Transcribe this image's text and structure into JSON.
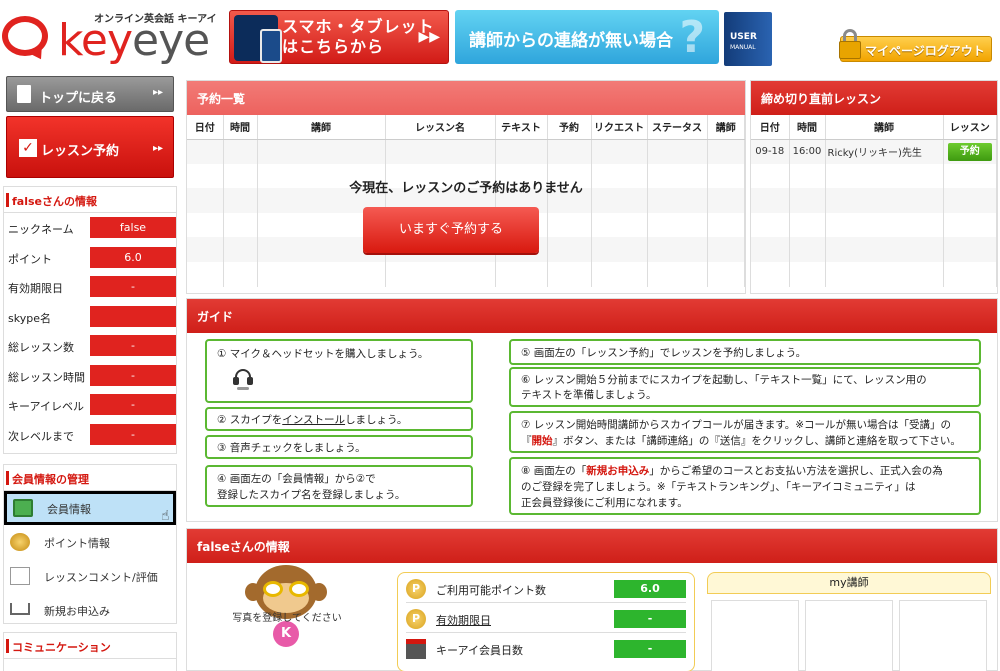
{
  "header": {
    "logo_tagline": "オンライン英会話 キーアイ",
    "logo_word_a": "key",
    "logo_word_b": "eye",
    "banner_smartphone_line1": "スマホ・タブレット",
    "banner_smartphone_line2": "はこちらから",
    "banner_contact": "講師からの連絡が無い場合",
    "manual_line1": "USER",
    "manual_line2": "MANUAL",
    "logout_label": "マイページログアウト"
  },
  "sidebar": {
    "top_button": "トップに戻る",
    "reserve_button": "レッスン予約",
    "arrows": "▸▸",
    "user_info_title": "falseさんの情報",
    "user_info": [
      {
        "key": "ニックネーム",
        "value": "false"
      },
      {
        "key": "ポイント",
        "value": "6.0"
      },
      {
        "key": "有効期限日",
        "value": "-"
      },
      {
        "key": "skype名",
        "value": ""
      },
      {
        "key": "総レッスン数",
        "value": "-"
      },
      {
        "key": "総レッスン時間",
        "value": "-"
      },
      {
        "key": "キーアイレベル",
        "value": "-"
      },
      {
        "key": "次レベルまで",
        "value": "-"
      }
    ],
    "mgmt_title": "会員情報の管理",
    "mgmt_items": [
      {
        "label": "会員情報",
        "icon": "member-card-icon"
      },
      {
        "label": "ポイント情報",
        "icon": "coins-icon"
      },
      {
        "label": "レッスンコメント/評価",
        "icon": "pencil-note-icon"
      },
      {
        "label": "新規お申込み",
        "icon": "cart-icon"
      }
    ],
    "community_title": "コミュニケーション"
  },
  "reservations": {
    "title": "予約一覧",
    "columns": [
      "日付",
      "時間",
      "講師",
      "レッスン名",
      "テキスト",
      "予約",
      "リクエスト",
      "ステータス",
      "講師"
    ],
    "empty_message": "今現在、レッスンのご予約はありません",
    "reserve_now": "いますぐ予約する"
  },
  "deadline": {
    "title": "締め切り直前レッスン",
    "columns": [
      "日付",
      "時間",
      "講師",
      "レッスン"
    ],
    "rows": [
      {
        "date": "09-18",
        "time": "16:00",
        "tutor": "Ricky(リッキー)先生",
        "action": "予約"
      }
    ]
  },
  "guide": {
    "title": "ガイド",
    "step1": "① マイク＆ヘッドセットを購入しましょう。",
    "step2_a": "② スカイプを",
    "step2_link": "インストール",
    "step2_b": "しましょう。",
    "step3": "③ 音声チェックをしましょう。",
    "step4_line1": "④ 画面左の「会員情報」から②で",
    "step4_line2": "登録したスカイプ名を登録しましょう。",
    "step5": "⑤ 画面左の「レッスン予約」でレッスンを予約しましょう。",
    "step6_line1": "⑥ レッスン開始５分前までにスカイプを起動し、「テキスト一覧」にて、レッスン用の",
    "step6_line2": "テキストを準備しましょう。",
    "step7_line1": "⑦ レッスン開始時間講師からスカイプコールが届きます。※コールが無い場合は「受講」の",
    "step7_l2_a": "『",
    "step7_l2_red": "開始",
    "step7_l2_b": "』ボタン、または「講師連絡」の『送信』をクリックし、講師と連絡を取って下さい。",
    "step8_l1_a": "⑧ 画面左の「",
    "step8_l1_red": "新規お申込み",
    "step8_l1_b": "」からご希望のコースとお支払い方法を選択し、正式入会の為",
    "step8_line2": "のご登録を完了しましょう。※「テキストランキング」、「キーアイコミュニティ」は",
    "step8_line3": "正会員登録後にご利用になれます。"
  },
  "user_panel": {
    "title": "falseさんの情報",
    "photo_caption": "写真を登録してください",
    "mascot_letter": "K",
    "points_label": "ご利用可能ポイント数",
    "points_value": "6.0",
    "expiry_label": "有効期限日",
    "expiry_value": "-",
    "days_label": "キーアイ会員日数",
    "days_value": "-",
    "coin_letter": "P",
    "my_tutor_title": "my講師"
  },
  "colors": {
    "brand_red": "#e0231f",
    "green": "#2db52d",
    "guide_border": "#5bb832",
    "sky": "#2fa5dc",
    "gold": "#f2a400"
  }
}
